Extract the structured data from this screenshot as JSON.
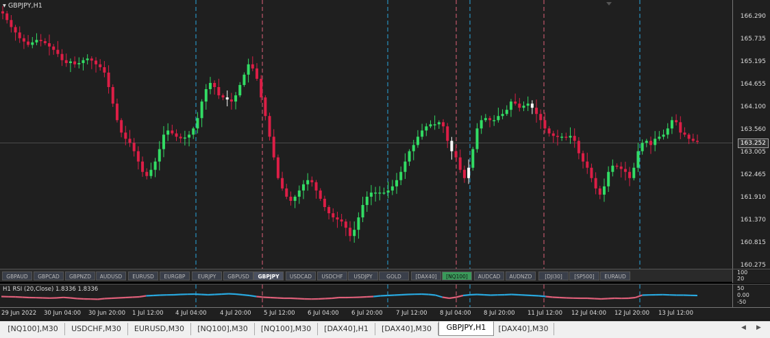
{
  "chart": {
    "title": "GBPJPY,H1",
    "current_price": "163.252",
    "price_ticks": [
      "166.290",
      "165.735",
      "165.195",
      "164.655",
      "164.100",
      "163.560",
      "163.005",
      "162.465",
      "161.910",
      "161.370",
      "160.815",
      "160.275"
    ]
  },
  "symbol_buttons": [
    "GBPAUD",
    "GBPCAD",
    "GBPNZD",
    "AUDUSD",
    "EURUSD",
    "EURGBP",
    "EURJPY",
    "GBPUSD",
    "GBPJPY",
    "USDCAD",
    "USDCHF",
    "USDJPY",
    "GOLD",
    "[DAX40]",
    "[NQ100]",
    "AUDCAD",
    "AUDNZD",
    "[DJI30]",
    "[SP500]",
    "EURAUD"
  ],
  "symbol_active": "GBPJPY",
  "symbol_green": "[NQ100]",
  "sub_axis": {
    "top": "100",
    "bottom": "20"
  },
  "rsi": {
    "label": "H1 RSI (20,Close) 1.8336 1.8336",
    "axis": [
      "50",
      "0.00",
      "-50"
    ]
  },
  "time_labels": [
    "29 Jun 2022",
    "30 Jun 04:00",
    "30 Jun 20:00",
    "1 Jul 12:00",
    "4 Jul 04:00",
    "4 Jul 20:00",
    "5 Jul 12:00",
    "6 Jul 04:00",
    "6 Jul 20:00",
    "7 Jul 12:00",
    "8 Jul 04:00",
    "8 Jul 20:00",
    "11 Jul 12:00",
    "12 Jul 04:00",
    "12 Jul 20:00",
    "13 Jul 12:00"
  ],
  "tabs": [
    "[NQ100],M30",
    "USDCHF,M30",
    "EURUSD,M30",
    "[NQ100],M30",
    "[NQ100],M30",
    "[DAX40],H1",
    "[DAX40],M30",
    "GBPJPY,H1",
    "[DAX40],M30"
  ],
  "active_tab": "GBPJPY,H1",
  "colors": {
    "bear": "#dc1e46",
    "bull": "#32dc64",
    "neutral": "#ffffff",
    "vline_blue": "#29a9e0",
    "vline_red": "#e0607a",
    "rsi_red": "#e0607a",
    "rsi_blue": "#29a9e0"
  },
  "candle_path": [
    166.38,
    166.22,
    166.05,
    165.92,
    165.78,
    165.7,
    165.62,
    165.68,
    165.74,
    165.71,
    165.66,
    165.58,
    165.5,
    165.4,
    165.25,
    165.18,
    165.22,
    165.15,
    165.18,
    165.25,
    165.29,
    165.24,
    165.15,
    165.08,
    164.95,
    164.6,
    164.2,
    163.8,
    163.5,
    163.35,
    163.25,
    163.05,
    162.8,
    162.55,
    162.45,
    162.6,
    162.8,
    163.1,
    163.45,
    163.55,
    163.48,
    163.4,
    163.36,
    163.38,
    163.45,
    163.6,
    163.85,
    164.25,
    164.55,
    164.7,
    164.6,
    164.4,
    164.35,
    164.3,
    164.25,
    164.4,
    164.65,
    164.9,
    165.15,
    165.05,
    164.8,
    164.35,
    163.9,
    163.4,
    162.9,
    162.4,
    162.15,
    161.95,
    161.85,
    161.95,
    162.1,
    162.25,
    162.35,
    162.3,
    162.1,
    161.9,
    161.7,
    161.55,
    161.45,
    161.4,
    161.35,
    161.2,
    161.0,
    161.15,
    161.45,
    161.75,
    161.95,
    162.05,
    162.05,
    162.05,
    162.05,
    162.1,
    162.2,
    162.35,
    162.55,
    162.8,
    163.05,
    163.2,
    163.4,
    163.55,
    163.65,
    163.7,
    163.7,
    163.75,
    163.65,
    163.3,
    163.05,
    162.9,
    162.6,
    162.4,
    162.65,
    163.1,
    163.6,
    163.8,
    163.85,
    163.8,
    163.8,
    163.9,
    163.95,
    164.05,
    164.25,
    164.2,
    164.1,
    164.15,
    164.2,
    164.1,
    163.95,
    163.8,
    163.6,
    163.48,
    163.42,
    163.4,
    163.4,
    163.38,
    163.42,
    163.3,
    163.0,
    162.8,
    162.65,
    162.4,
    162.15,
    162.0,
    162.2,
    162.55,
    162.7,
    162.68,
    162.62,
    162.55,
    162.4,
    162.65,
    163.05,
    163.25,
    163.3,
    163.2,
    163.35,
    163.4,
    163.45,
    163.6,
    163.8,
    163.75,
    163.5,
    163.45,
    163.35,
    163.3,
    163.28
  ],
  "rsi_values": [
    -0.5,
    -0.8,
    -1.0,
    -1.5,
    -2.0,
    -2.2,
    -2.5,
    -2.8,
    -2.5,
    -1.8,
    -2.5,
    -3.5,
    -4.0,
    -4.2,
    -4.5,
    -3.5,
    -3.0,
    -2.5,
    -2.0,
    -1.5,
    -1.0,
    0.5,
    1.0,
    1.5,
    1.8,
    2.0,
    2.5,
    2.8,
    3.0,
    2.5,
    2.0,
    2.5,
    3.0,
    3.5,
    3.0,
    2.0,
    1.0,
    -0.5,
    -1.5,
    -2.0,
    -2.5,
    -3.0,
    -3.0,
    -3.5,
    -4.0,
    -4.2,
    -4.0,
    -3.5,
    -3.0,
    -2.0,
    -2.0,
    -1.8,
    -1.5,
    -1.0,
    -0.5,
    0.5,
    1.0,
    1.5,
    2.0,
    2.5,
    2.8,
    3.0,
    2.5,
    1.5,
    -1.5,
    -3.0,
    -1.5,
    1.0,
    2.0,
    2.5,
    2.0,
    1.5,
    1.8,
    2.0,
    2.5,
    2.0,
    1.5,
    1.0,
    0.5,
    -0.5,
    -1.5,
    -2.0,
    -2.5,
    -2.8,
    -3.0,
    -3.0,
    -3.5,
    -4.0,
    -3.5,
    -3.0,
    -3.2,
    -3.0,
    -2.0,
    1.5,
    1.8,
    2.0,
    2.2,
    1.8,
    1.5,
    1.5,
    1.2,
    1.0
  ]
}
